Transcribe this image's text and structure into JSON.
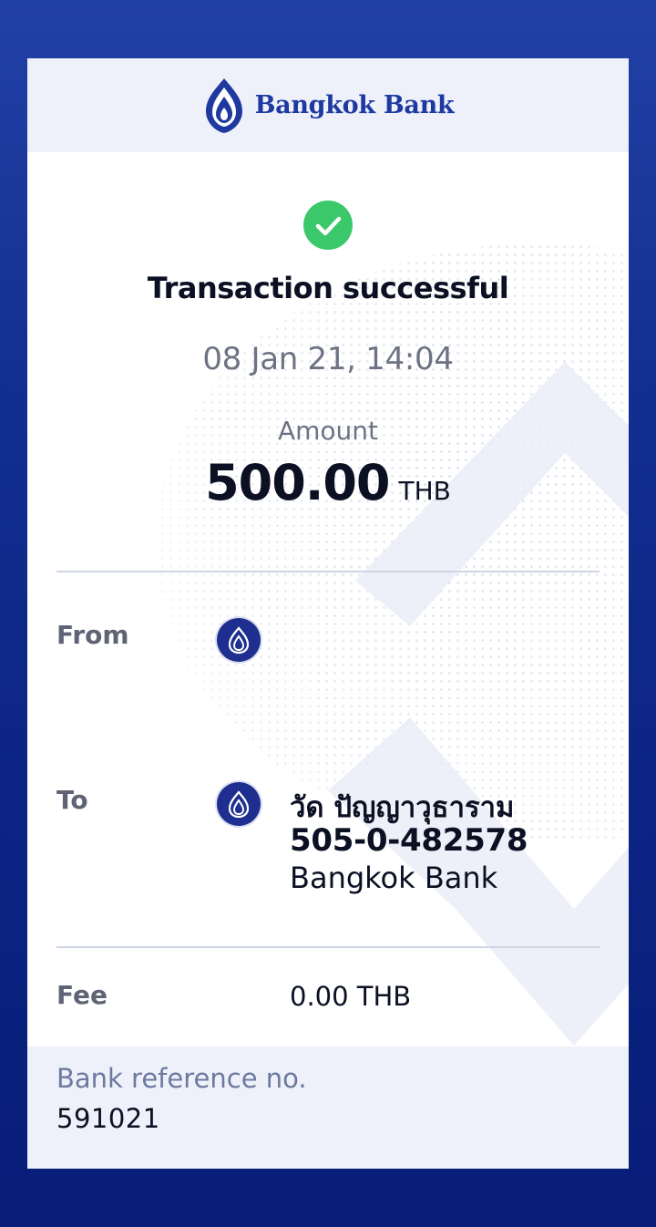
{
  "brand": {
    "name": "Bangkok Bank",
    "logo_icon": "bangkok-bank-lotus-icon",
    "color": "#1e3aa0"
  },
  "status": {
    "icon": "checkmark-icon",
    "title": "Transaction successful",
    "datetime": "08 Jan 21, 14:04",
    "color": "#3ac86a"
  },
  "amount": {
    "label": "Amount",
    "value": "500.00",
    "currency": "THB"
  },
  "from": {
    "label": "From",
    "bank_icon": "bangkok-bank-badge-icon"
  },
  "to": {
    "label": "To",
    "bank_icon": "bangkok-bank-badge-icon",
    "name": "วัด ปัญญาวุธาราม",
    "account": "505-0-482578",
    "bank": "Bangkok Bank"
  },
  "fee": {
    "label": "Fee",
    "value": "0.00 THB"
  },
  "reference": {
    "label": "Bank reference no.",
    "value": "591021"
  }
}
